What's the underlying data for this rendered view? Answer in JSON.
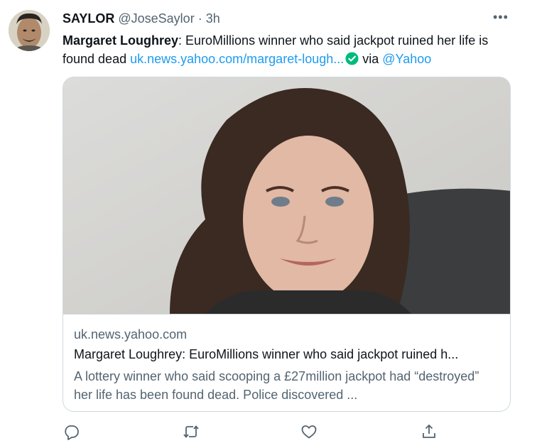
{
  "tweet": {
    "author_name": "SAYLOR",
    "handle": "@JoseSaylor",
    "separator": "·",
    "time": "3h",
    "more_label": "•••",
    "text_bold": "Margaret Loughrey",
    "text_body": ": EuroMillions winner who said jackpot ruined her life is found dead ",
    "link_text": "uk.news.yahoo.com/margaret-lough...",
    "via_text": " via ",
    "via_handle": "@Yahoo"
  },
  "card": {
    "domain": "uk.news.yahoo.com",
    "title": "Margaret Loughrey: EuroMillions winner who said jackpot ruined h...",
    "description": "A lottery winner who said scooping a £27million jackpot had “destroyed” her life has been found dead. Police discovered ..."
  },
  "icons": {
    "verified": "verified-check-icon",
    "reply": "reply-icon",
    "retweet": "retweet-icon",
    "like": "heart-icon",
    "share": "share-icon"
  },
  "colors": {
    "link": "#1d9bf0",
    "verified": "#00ba7c",
    "secondary_text": "#536471",
    "border": "#cfd9de"
  }
}
